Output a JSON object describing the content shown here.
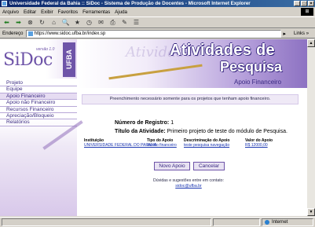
{
  "window": {
    "title": "Universidade Federal da Bahia :: SiDoc - Sistema de Produção de Docentes - Microsoft Internet Explorer",
    "controls": [
      "_",
      "□",
      "×"
    ]
  },
  "menubar": {
    "items": [
      "Arquivo",
      "Editar",
      "Exibir",
      "Favoritos",
      "Ferramentas",
      "Ajuda"
    ]
  },
  "toolbar": {
    "back": "⬅",
    "forward": "➡",
    "stop": "⊗",
    "refresh": "↻",
    "home": "⌂",
    "search": "🔍",
    "favorites": "★",
    "history": "◷",
    "mail": "✉",
    "print": "⎙",
    "edit": "✎",
    "discuss": "☰"
  },
  "addressbar": {
    "label": "Endereço",
    "url": "https://www.sidoc.ufba.br/index.sp",
    "go": "▸",
    "links": "Links »"
  },
  "sidebar": {
    "logo": "SiDoc",
    "version": "versão 1.0",
    "ufba": "UFBA",
    "items": [
      {
        "label": "Projeto"
      },
      {
        "label": "Equipe"
      },
      {
        "label": "Apoio Financeiro"
      },
      {
        "label": "Apoio não Financeiro"
      },
      {
        "label": "Recursos Financeiro"
      },
      {
        "label": "Apreciação/Bloqueio"
      },
      {
        "label": "Relatórios"
      }
    ]
  },
  "banner": {
    "ghost": "Atividades",
    "title_line1": "Atividades de",
    "title_line2": "Pesquisa",
    "subtitle": "Apoio Financeiro"
  },
  "notice": "Preenchimento necessário somente para os projetos que tenham apoio financeiro.",
  "form": {
    "registro_label": "Número de Registro:",
    "registro_value": "1",
    "titulo_label": "Título da Atividade:",
    "titulo_value": "Primeiro projeto de teste do módulo de Pesquisa."
  },
  "table": {
    "headers": [
      "Instituição",
      "Tipo do Apoio",
      "Descriminação do Apoio",
      "Valor do Apoio"
    ],
    "rows": [
      [
        "UNIVERSIDADE FEDERAL DO PARANA",
        "Auxilio financeiro",
        "teste pesquisa navegação",
        "R$ 12000,00"
      ]
    ]
  },
  "buttons": {
    "novo": "Novo Apoio",
    "cancelar": "Cancelar"
  },
  "footer": {
    "line1": "Dúvidas e sugestões entre em contato:",
    "email": "sidoc@ufba.br"
  },
  "statusbar": {
    "zone": "Internet"
  }
}
